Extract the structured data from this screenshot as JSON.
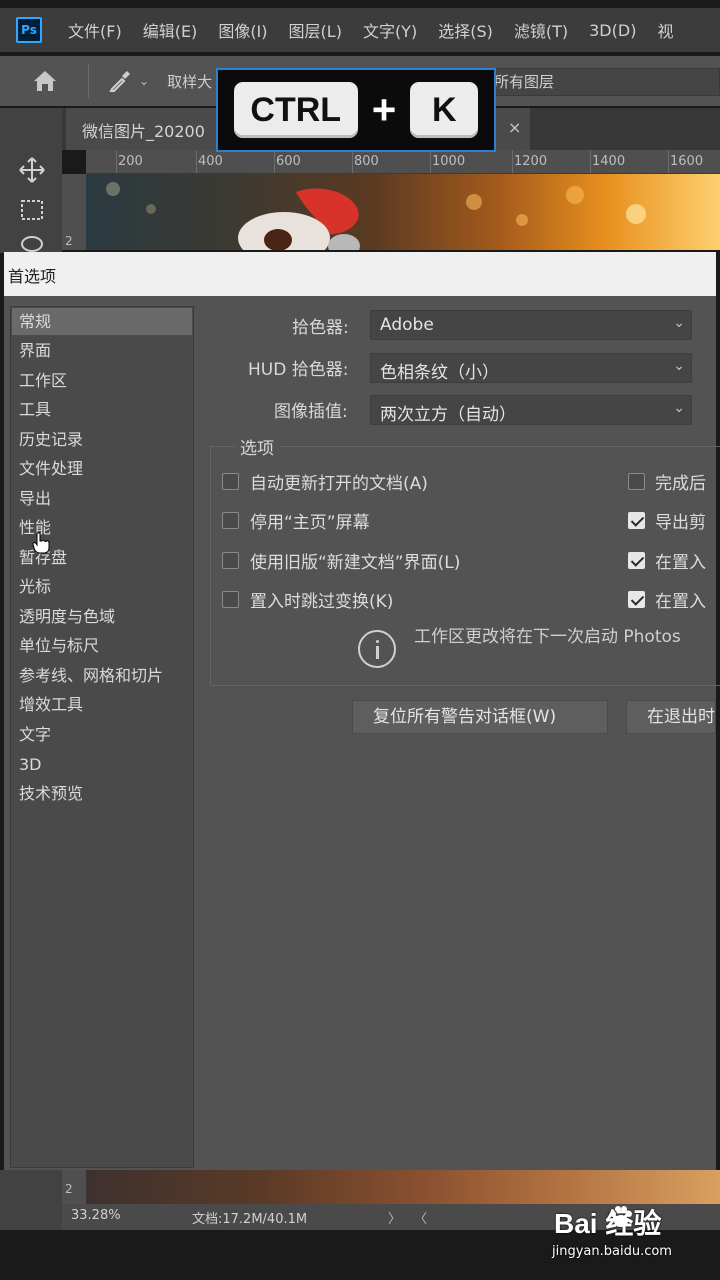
{
  "app": {
    "logo": "Ps",
    "menu": [
      "文件(F)",
      "编辑(E)",
      "图像(I)",
      "图层(L)",
      "文字(Y)",
      "选择(S)",
      "滤镜(T)",
      "3D(D)",
      "视"
    ]
  },
  "options_bar": {
    "sample_label": "取样大",
    "sample_layers": "所有图层"
  },
  "shortcut": {
    "key1": "CTRL",
    "plus": "+",
    "key2": "K"
  },
  "document": {
    "tab_title": "微信图片_20200",
    "tab_close": "×",
    "ruler_marks": [
      "200",
      "400",
      "600",
      "800",
      "1000",
      "1200",
      "1400",
      "1600"
    ],
    "vruler_mark": "2"
  },
  "dialog": {
    "title": "首选项",
    "sidebar": [
      "常规",
      "界面",
      "工作区",
      "工具",
      "历史记录",
      "文件处理",
      "导出",
      "性能",
      "暂存盘",
      "光标",
      "透明度与色域",
      "单位与标尺",
      "参考线、网格和切片",
      "增效工具",
      "文字",
      "3D",
      "技术预览"
    ],
    "active_index": 0,
    "color_picker": {
      "label": "拾色器:",
      "value": "Adobe"
    },
    "hud_picker": {
      "label": "HUD 拾色器:",
      "value": "色相条纹（小）"
    },
    "interpolation": {
      "label": "图像插值:",
      "value": "两次立方（自动）"
    },
    "options_legend": "选项",
    "checkboxes_left": [
      {
        "label": "自动更新打开的文档(A)",
        "checked": false
      },
      {
        "label": "停用“主页”屏幕",
        "checked": false
      },
      {
        "label": "使用旧版“新建文档”界面(L)",
        "checked": false
      },
      {
        "label": "置入时跳过变换(K)",
        "checked": false
      }
    ],
    "checkboxes_right": [
      {
        "label": "完成后",
        "checked": false
      },
      {
        "label": "导出剪",
        "checked": true
      },
      {
        "label": "在置入",
        "checked": true
      },
      {
        "label": "在置入",
        "checked": true
      }
    ],
    "info_text": "工作区更改将在下一次启动 Photos",
    "reset_button": "复位所有警告对话框(W)",
    "exit_button": "在退出时"
  },
  "status": {
    "zoom": "33.28%",
    "doc_size": "文档:17.2M/40.1M",
    "arrow_right": "〉",
    "arrow_left": "〈",
    "vruler_mark": "2"
  },
  "watermark": {
    "logo": "Bai  经验",
    "url": "jingyan.baidu.com"
  },
  "colors": {
    "accent": "#31a8ff",
    "panel": "#535353",
    "sidebar_active": "#6a6a6a"
  }
}
